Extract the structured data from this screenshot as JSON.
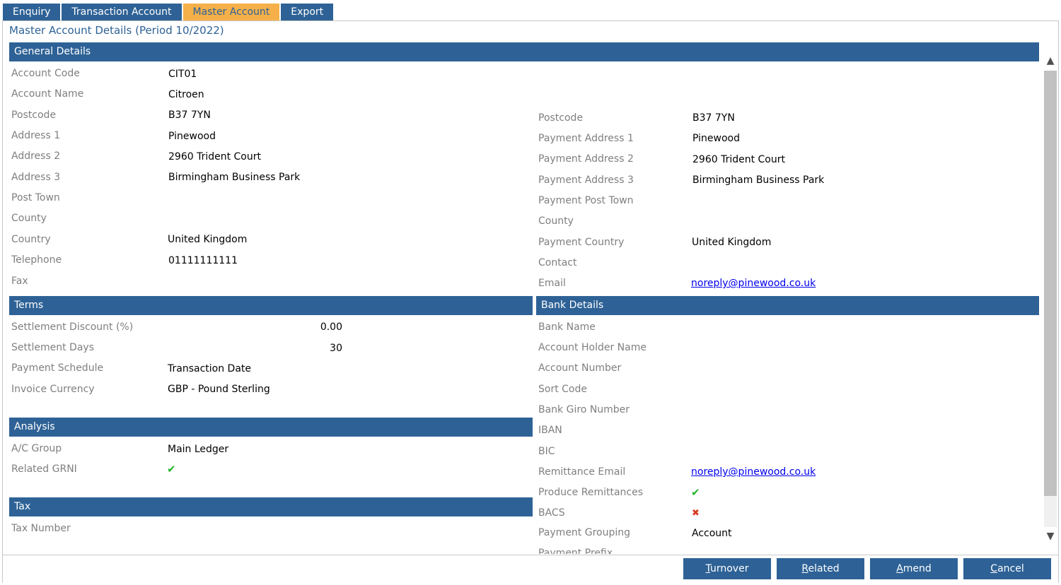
{
  "tabs": [
    {
      "label": "Enquiry",
      "active": false
    },
    {
      "label": "Transaction Account",
      "active": false
    },
    {
      "label": "Master Account",
      "active": true
    },
    {
      "label": "Export",
      "active": false
    }
  ],
  "page_title": "Master Account Details (Period 10/2022)",
  "sections": {
    "general": "General Details",
    "terms": "Terms",
    "bank": "Bank Details",
    "analysis": "Analysis",
    "tax": "Tax"
  },
  "general_left": [
    {
      "label": "Account Code",
      "value": "CIT01"
    },
    {
      "label": "Account Name",
      "value": "Citroen"
    },
    {
      "label": "Postcode",
      "value": "B37 7YN"
    },
    {
      "label": "Address 1",
      "value": "Pinewood"
    },
    {
      "label": "Address 2",
      "value": "2960 Trident Court"
    },
    {
      "label": "Address 3",
      "value": "Birmingham Business Park"
    },
    {
      "label": "Post Town",
      "value": ""
    },
    {
      "label": "County",
      "value": ""
    },
    {
      "label": "Country",
      "value": "United Kingdom"
    },
    {
      "label": "Telephone",
      "value": "01111111111"
    },
    {
      "label": "Fax",
      "value": ""
    }
  ],
  "general_right": [
    {
      "label": "Postcode",
      "value": "B37 7YN"
    },
    {
      "label": "Payment Address 1",
      "value": "Pinewood"
    },
    {
      "label": "Payment Address 2",
      "value": "2960 Trident Court"
    },
    {
      "label": "Payment Address 3",
      "value": "Birmingham Business Park"
    },
    {
      "label": "Payment Post Town",
      "value": ""
    },
    {
      "label": "County",
      "value": ""
    },
    {
      "label": "Payment Country",
      "value": "United Kingdom"
    },
    {
      "label": "Contact",
      "value": ""
    },
    {
      "label": "Email",
      "value": "noreply@pinewood.co.uk"
    }
  ],
  "terms": [
    {
      "label": "Settlement Discount (%)",
      "value": "0.00"
    },
    {
      "label": "Settlement Days",
      "value": "30"
    },
    {
      "label": "Payment Schedule",
      "value": "Transaction Date"
    },
    {
      "label": "Invoice Currency",
      "value": "GBP - Pound Sterling"
    }
  ],
  "analysis": [
    {
      "label": "A/C Group",
      "value": "Main Ledger"
    },
    {
      "label": "Related GRNI",
      "value": "✔"
    }
  ],
  "tax": [
    {
      "label": "Tax Number",
      "value": ""
    }
  ],
  "bank": [
    {
      "label": "Bank Name",
      "value": ""
    },
    {
      "label": "Account Holder Name",
      "value": ""
    },
    {
      "label": "Account Number",
      "value": ""
    },
    {
      "label": "Sort Code",
      "value": ""
    },
    {
      "label": "Bank Giro Number",
      "value": ""
    },
    {
      "label": "IBAN",
      "value": ""
    },
    {
      "label": "BIC",
      "value": ""
    },
    {
      "label": "Remittance Email",
      "value": "noreply@pinewood.co.uk"
    },
    {
      "label": "Produce Remittances",
      "value": "✔"
    },
    {
      "label": "BACS",
      "value": "✖"
    },
    {
      "label": "Payment Grouping",
      "value": "Account"
    },
    {
      "label": "Payment Prefix",
      "value": ""
    }
  ],
  "scrollbar": {
    "up": "▲",
    "down": "▼"
  },
  "buttons": [
    {
      "key": "T",
      "rest": "urnover"
    },
    {
      "key": "R",
      "rest": "elated"
    },
    {
      "key": "A",
      "rest": "mend"
    },
    {
      "key": "C",
      "rest": "ancel"
    }
  ],
  "colors": {
    "header": "#2e6296",
    "active_tab": "#f5b04a",
    "label": "#7f7f7f",
    "link": "#0000ee",
    "check": "#22b52c",
    "cross": "#d8391f"
  }
}
